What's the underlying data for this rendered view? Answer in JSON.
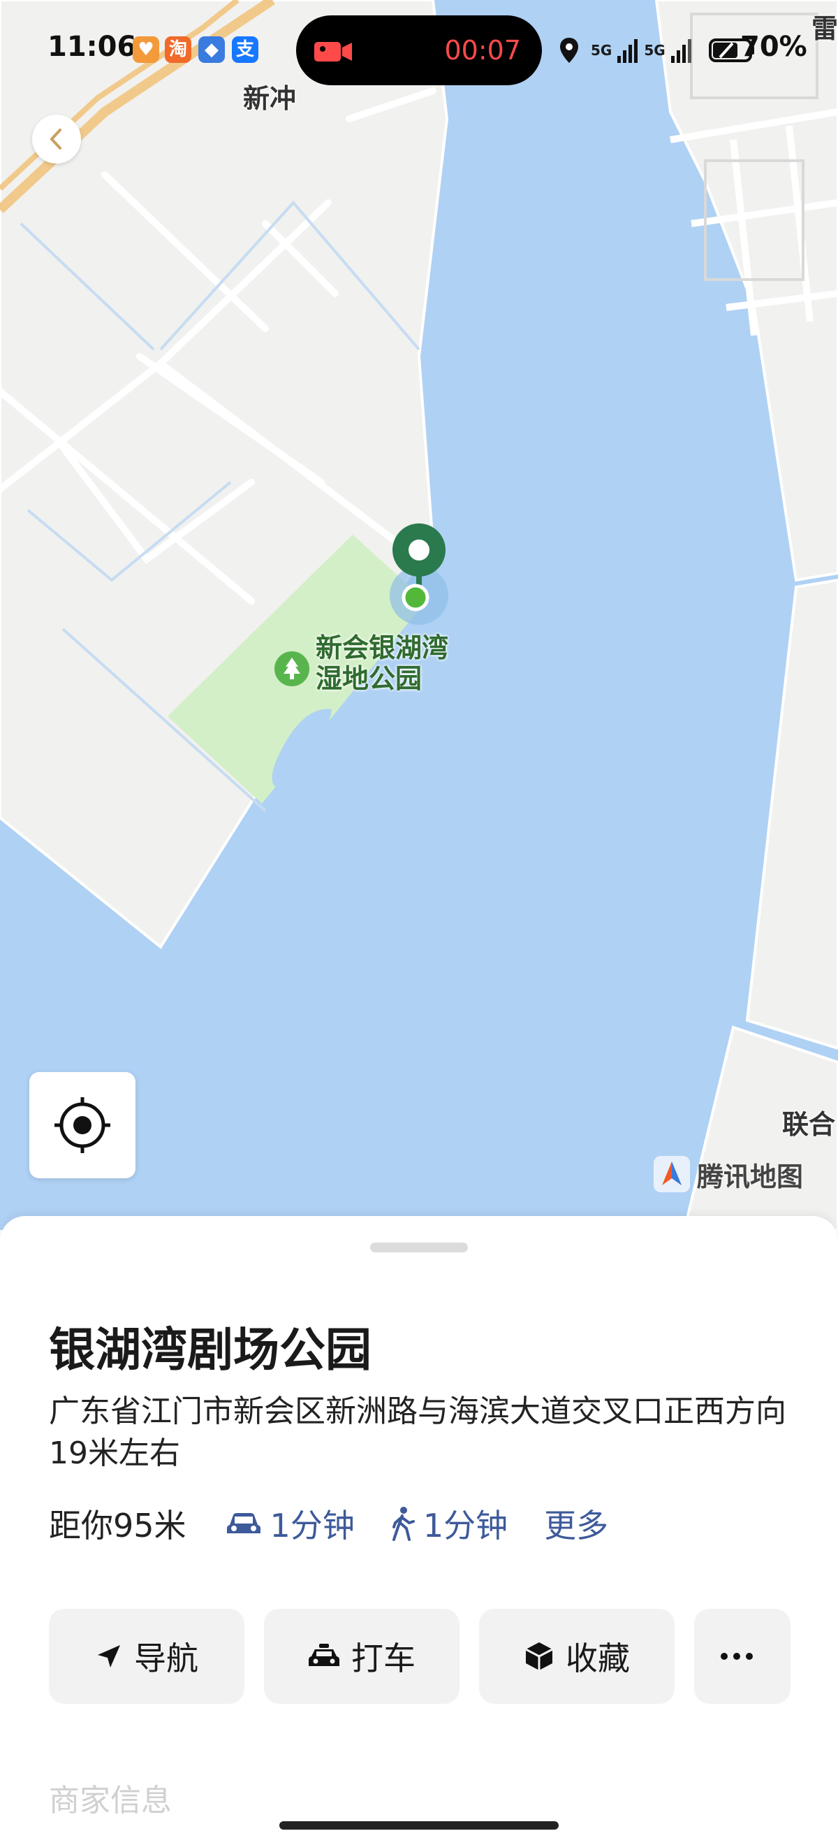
{
  "status_bar": {
    "time": "11:06",
    "apps": [
      "淘",
      "支"
    ],
    "recording_timer": "00:07",
    "signal_1": "5G",
    "signal_2": "5G",
    "battery": "70%"
  },
  "map": {
    "labels": {
      "town_top": "新冲",
      "park_line1": "新会银湖湾",
      "park_line2": "湿地公园",
      "bottom_right": "联合",
      "top_right_edge": "雷"
    },
    "attribution": "腾讯地图",
    "colors": {
      "water": "#afd1f4",
      "land": "#f1f1ef",
      "park": "#d3efc7",
      "pin": "#2a7a4e",
      "dot": "#53b83a"
    }
  },
  "place": {
    "name": "银湖湾剧场公园",
    "address": "广东省江门市新会区新洲路与海滨大道交叉口正西方向19米左右",
    "distance": "距你95米",
    "drive_time": "1分钟",
    "walk_time": "1分钟",
    "more_label": "更多"
  },
  "actions": {
    "navigate": "导航",
    "taxi": "打车",
    "favorite": "收藏"
  },
  "faded_section": "商家信息"
}
